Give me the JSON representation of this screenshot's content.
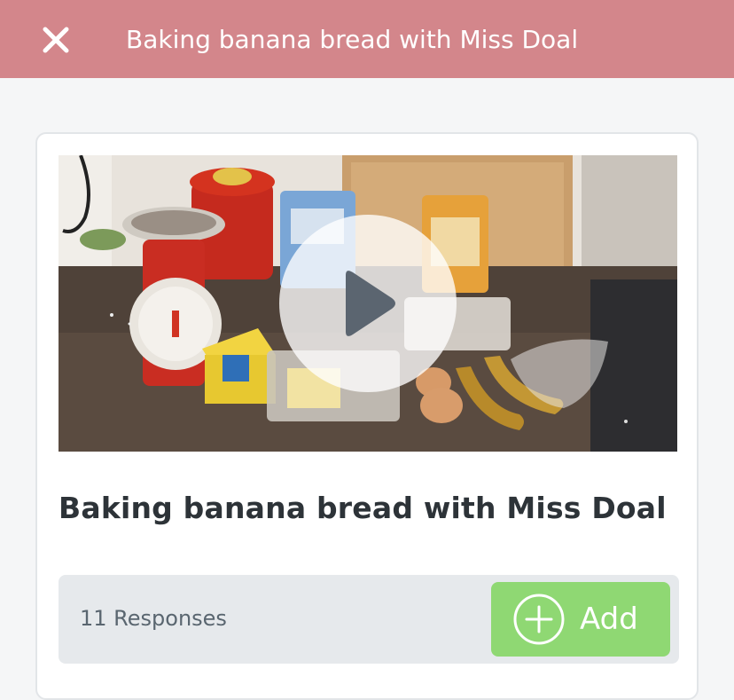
{
  "header": {
    "title": "Baking banana bread with Miss Doal",
    "close_icon": "close-icon",
    "background_color": "#d3868b"
  },
  "video": {
    "thumbnail_description_icon": "play-icon"
  },
  "card": {
    "title": "Baking banana bread with Miss Doal"
  },
  "responses": {
    "count_label": "11 Responses",
    "add_label": "Add",
    "add_icon": "plus-circle-icon",
    "add_color": "#8fd873"
  }
}
